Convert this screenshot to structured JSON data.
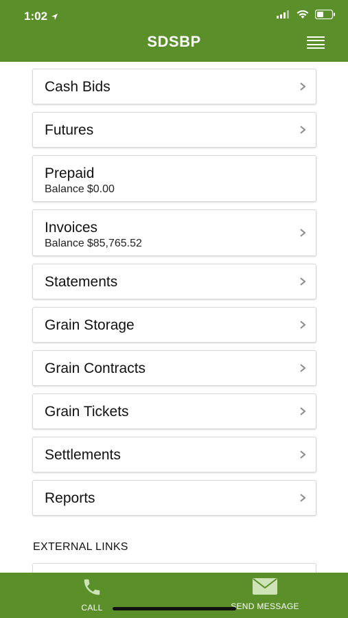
{
  "status_bar": {
    "time": "1:02"
  },
  "header": {
    "title": "SDSBP"
  },
  "menu": [
    {
      "label": "Cash Bids",
      "chevron": true
    },
    {
      "label": "Futures",
      "chevron": true
    },
    {
      "label": "Prepaid",
      "sub_label": "Balance",
      "sub_value": "$0.00",
      "chevron": false
    },
    {
      "label": "Invoices",
      "sub_label": "Balance",
      "sub_value": "$85,765.52",
      "chevron": true
    },
    {
      "label": "Statements",
      "chevron": true
    },
    {
      "label": "Grain Storage",
      "chevron": true
    },
    {
      "label": "Grain Contracts",
      "chevron": true
    },
    {
      "label": "Grain Tickets",
      "chevron": true
    },
    {
      "label": "Settlements",
      "chevron": true
    },
    {
      "label": "Reports",
      "chevron": true
    }
  ],
  "external_links": {
    "title": "EXTERNAL LINKS"
  },
  "bottom_bar": {
    "call_label": "CALL",
    "send_label": "SEND MESSAGE"
  },
  "colors": {
    "brand_green": "#5a8f2a"
  }
}
